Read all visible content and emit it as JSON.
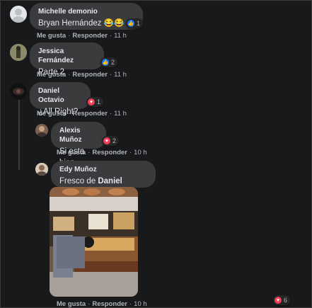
{
  "comments": [
    {
      "author": "Michelle demonio",
      "text": "Bryan Hernández 😂😂",
      "reaction": {
        "type": "like",
        "count": "1"
      },
      "actions": {
        "like": "Me gusta",
        "reply": "Responder",
        "time": "11 h"
      }
    },
    {
      "author": "Jessica Fernández",
      "text": "Parte 2",
      "reaction": {
        "type": "like",
        "count": "2"
      },
      "actions": {
        "like": "Me gusta",
        "reply": "Responder",
        "time": "11 h"
      }
    },
    {
      "author": "Daniel Octavio",
      "text": "¿All Right?",
      "reaction": {
        "type": "love",
        "count": "1"
      },
      "actions": {
        "like": "Me gusta",
        "reply": "Responder",
        "time": "11 h"
      }
    },
    {
      "author": "Alexis Muñoz",
      "text": "Si esta bien",
      "reaction": {
        "type": "love",
        "count": "2"
      },
      "actions": {
        "like": "Me gusta",
        "reply": "Responder",
        "time": "10 h"
      }
    },
    {
      "author": "Edy Muñoz",
      "text_prefix": "Fresco de",
      "text_mention": "Daniel Octavio",
      "reaction": {
        "type": "love",
        "count": "6"
      },
      "actions": {
        "like": "Me gusta",
        "reply": "Responder",
        "time": "10 h"
      }
    }
  ],
  "colors": {
    "background": "#18191a",
    "bubble": "#3a3b3c",
    "like": "#1877f2",
    "love": "#f33e58"
  }
}
